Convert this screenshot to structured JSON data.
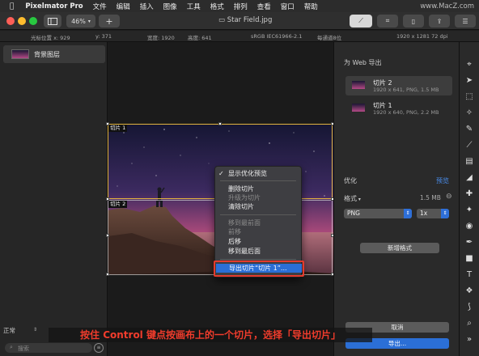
{
  "menubar": {
    "apple": "",
    "app_name": "Pixelmator Pro",
    "items": [
      "文件",
      "编辑",
      "插入",
      "图像",
      "工具",
      "格式",
      "排列",
      "查看",
      "窗口",
      "帮助"
    ],
    "watermark": "www.MacZ.com"
  },
  "titlebar": {
    "zoom": "46%",
    "add_label": "+",
    "doc_title": "Star Field.jpg"
  },
  "infobar": {
    "cursor_x": "光标位置 x:  929",
    "cursor_y": "y:  371",
    "width": "宽度: 1920",
    "height": "高度: 641",
    "color_profile": "sRGB IEC61966-2.1",
    "bit_depth": "每通道8位",
    "resolution": "1920 x 1281 72 dpi"
  },
  "layers": {
    "layer_name": "背景图层",
    "blend_mode": "正常",
    "search_placeholder": "搜索"
  },
  "canvas": {
    "slice1_label": "切片 1",
    "slice2_label": "切片 2"
  },
  "context_menu": {
    "items": [
      {
        "label": "显示优化预览",
        "checked": true,
        "enabled": true
      },
      {
        "label": "删除切片",
        "enabled": true
      },
      {
        "label": "升级为切片",
        "enabled": false
      },
      {
        "label": "清除切片",
        "enabled": true
      },
      {
        "label": "移到最前面",
        "enabled": false
      },
      {
        "label": "前移",
        "enabled": false
      },
      {
        "label": "后移",
        "enabled": true
      },
      {
        "label": "移到最后面",
        "enabled": true
      },
      {
        "label": "导出切片“切片 1”...",
        "enabled": true,
        "highlighted": true
      }
    ],
    "check": "✓"
  },
  "export_panel": {
    "title": "为 Web 导出",
    "slices": [
      {
        "name": "切片 2",
        "info": "1920 x 641, PNG, 1.5 MB"
      },
      {
        "name": "切片 1",
        "info": "1920 x 640, PNG, 2.2 MB"
      }
    ],
    "optimize_label": "优化",
    "preview_link": "预览",
    "format_label": "格式",
    "size": "1.5 MB",
    "format_value": "PNG",
    "scale_value": "1x",
    "add_format": "新增格式",
    "cancel": "取消",
    "export": "导出..."
  },
  "caption": "按住 Control 键点按画布上的一个切片，选择「导出切片」",
  "colors": {
    "accent": "#2b6fd6",
    "slice_border": "#e3b53f",
    "highlight_box": "#e53a2c",
    "caption_text": "#f03c2c"
  }
}
